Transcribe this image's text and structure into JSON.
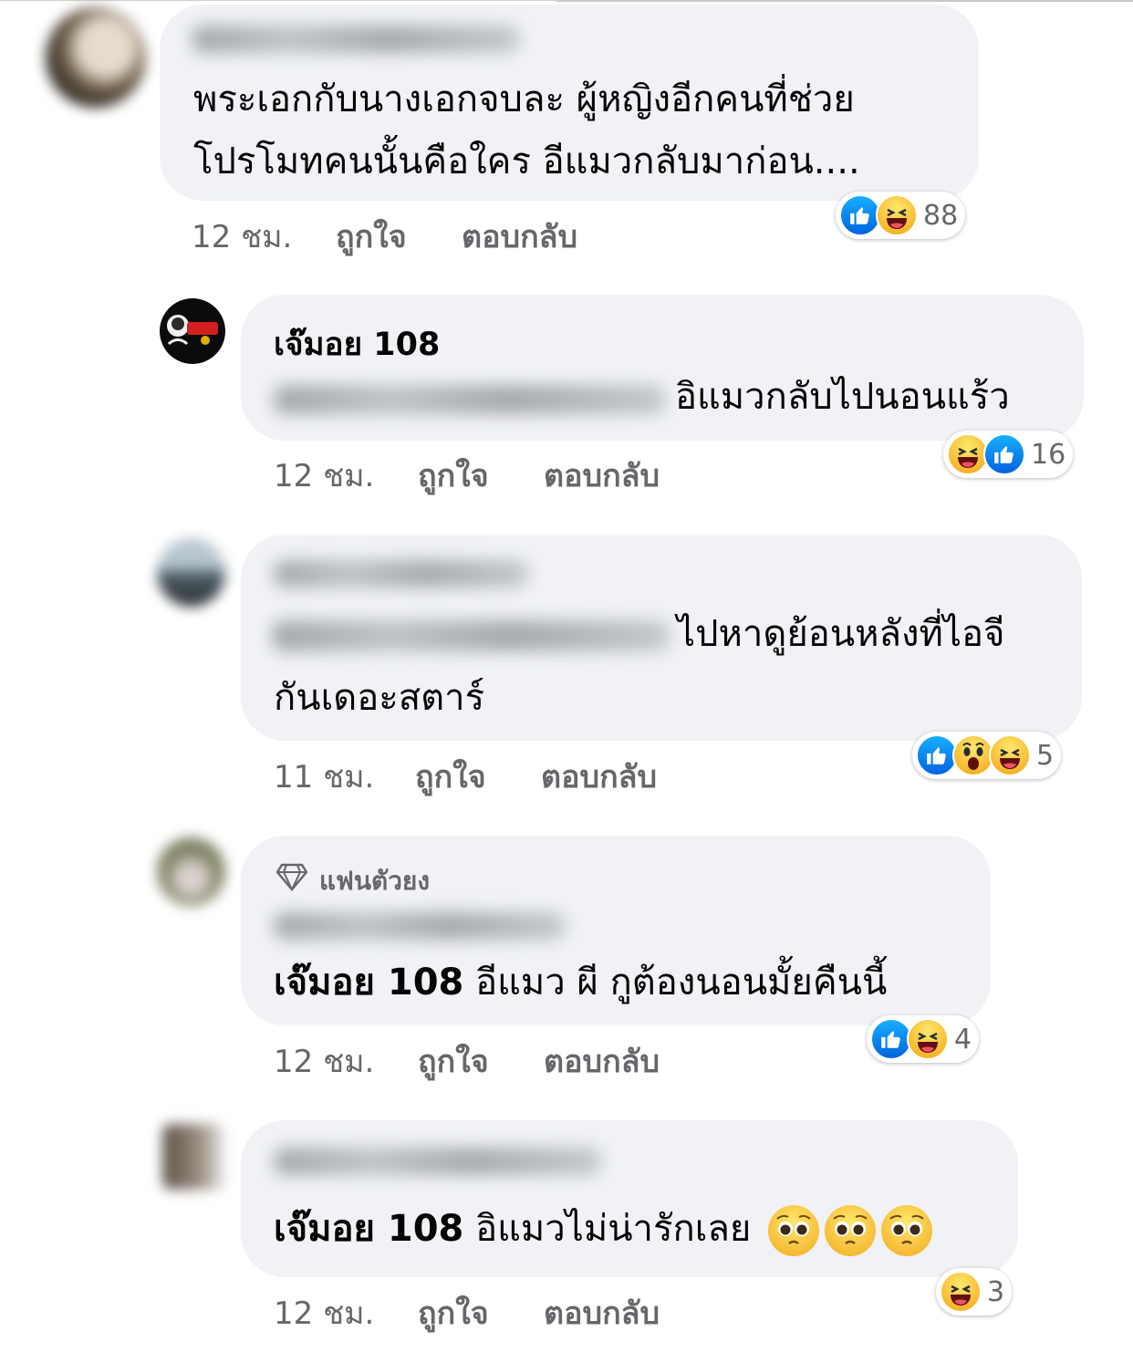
{
  "comments": [
    {
      "author": "",
      "author_blurred": true,
      "text_lines": [
        "พระเอกกับนางเอกจบละ ผู้หญิงอีกคนที่ช่วย",
        "โปรโมทคนนั้นคือใคร อีแมวกลับมาก่อน...."
      ],
      "time": "12 ชม.",
      "like": "ถูกใจ",
      "reply": "ตอบกลับ",
      "reactions": [
        "like",
        "haha"
      ],
      "reaction_count": "88"
    },
    {
      "author": "เจ๊มอย 108",
      "author_blurred": false,
      "mention_blurred": true,
      "text_lines": [
        "อิแมวกลับไปนอนแร้ว"
      ],
      "time": "12 ชม.",
      "like": "ถูกใจ",
      "reply": "ตอบกลับ",
      "reactions": [
        "haha",
        "like"
      ],
      "reaction_count": "16"
    },
    {
      "author": "",
      "author_blurred": true,
      "mention_blurred": true,
      "text_lines": [
        "ไปหาดูย้อนหลังที่ไอจี",
        "กันเดอะสตาร์"
      ],
      "time": "11 ชม.",
      "like": "ถูกใจ",
      "reply": "ตอบกลับ",
      "reactions": [
        "like",
        "wow",
        "haha"
      ],
      "reaction_count": "5"
    },
    {
      "badge": "แฟนตัวยง",
      "author": "",
      "author_blurred": true,
      "mention": "เจ๊มอย 108",
      "text_lines": [
        "อีแมว ผี กูต้องนอนมั้ยคืนนี้"
      ],
      "time": "12 ชม.",
      "like": "ถูกใจ",
      "reply": "ตอบกลับ",
      "reactions": [
        "like",
        "haha"
      ],
      "reaction_count": "4"
    },
    {
      "author": "",
      "author_blurred": true,
      "mention": "เจ๊มอย 108",
      "text_lines": [
        "อิแมวไม่น่ารักเลย"
      ],
      "emoji": [
        "pleading-face",
        "pleading-face",
        "pleading-face"
      ],
      "time": "12 ชม.",
      "like": "ถูกใจ",
      "reply": "ตอบกลับ",
      "reactions": [
        "haha"
      ],
      "reaction_count": "3"
    }
  ],
  "colors": {
    "bubble": "#f0f2f5",
    "meta_text": "#65676b",
    "like_blue": "#1877f2"
  }
}
